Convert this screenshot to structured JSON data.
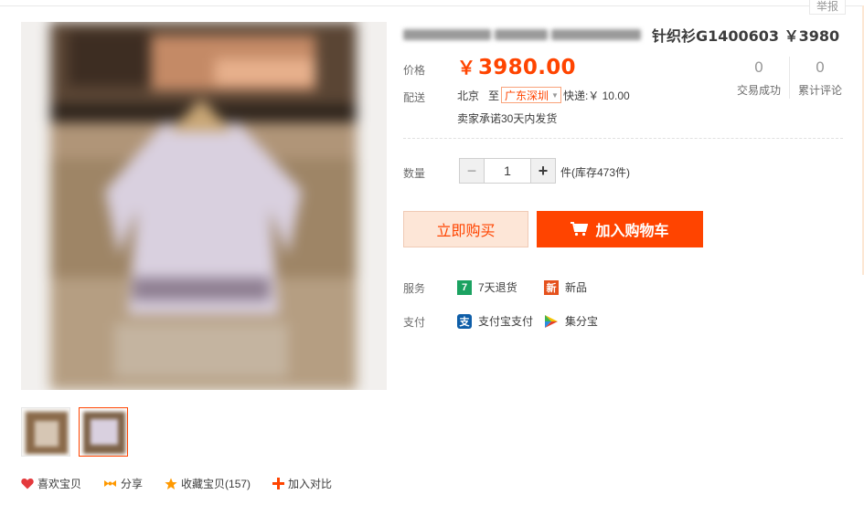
{
  "report": "举报",
  "product": {
    "title": "针织衫G1400603 ￥3980"
  },
  "price": {
    "label": "价格",
    "currency": "￥",
    "value": "3980.00"
  },
  "stats": [
    {
      "value": "0",
      "label": "交易成功"
    },
    {
      "value": "0",
      "label": "累计评论"
    }
  ],
  "shipping": {
    "label": "配送",
    "from": "北京",
    "to_word": "至",
    "destination": "广东深圳",
    "express": "快递:￥ 10.00",
    "promise": "卖家承诺30天内发货"
  },
  "quantity": {
    "label": "数量",
    "value": "1",
    "minus": "−",
    "plus": "+",
    "stock": "件(库存473件)"
  },
  "buttons": {
    "buy_now": "立即购买",
    "add_cart": "加入购物车"
  },
  "services": {
    "label": "服务",
    "items": [
      {
        "icon": "seven-day-return-icon",
        "glyph": "7",
        "text": "7天退货",
        "color": "#1ba261"
      },
      {
        "icon": "new-item-icon",
        "glyph": "新",
        "text": "新品",
        "color": "#e5511d"
      }
    ]
  },
  "payment": {
    "label": "支付",
    "items": [
      {
        "icon": "alipay-icon",
        "glyph": "支",
        "text": "支付宝支付",
        "color": "#0e5ea8"
      },
      {
        "icon": "jifenbao-icon",
        "text": "集分宝"
      }
    ]
  },
  "social": {
    "like": "喜欢宝贝",
    "share": "分享",
    "favorite": "收藏宝贝(157)",
    "compare": "加入对比"
  },
  "colors": {
    "accent": "#ff4400",
    "accent_light": "#fde6d7"
  }
}
